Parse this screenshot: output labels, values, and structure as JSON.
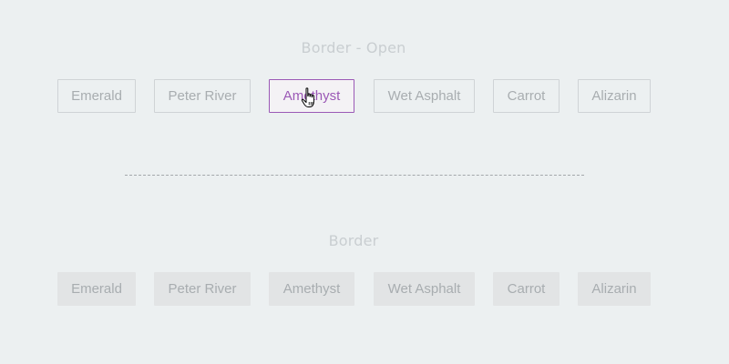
{
  "sections": {
    "open": {
      "title": "Border - Open",
      "buttons": [
        "Emerald",
        "Peter River",
        "Amethyst",
        "Wet Asphalt",
        "Carrot",
        "Alizarin"
      ],
      "active_button": "Amethyst"
    },
    "border": {
      "title": "Border",
      "buttons": [
        "Emerald",
        "Peter River",
        "Amethyst",
        "Wet Asphalt",
        "Carrot",
        "Alizarin"
      ]
    }
  },
  "colors": {
    "background": "#ecf0f1",
    "text_muted": "#a8adb0",
    "title_muted": "#c9ced1",
    "border_muted": "#cfd3d6",
    "filled_button_bg": "#e2e4e5",
    "accent_amethyst": "#9b59b6"
  },
  "cursor": {
    "icon": "hand-pointer-icon",
    "hover_target": "Amethyst"
  }
}
